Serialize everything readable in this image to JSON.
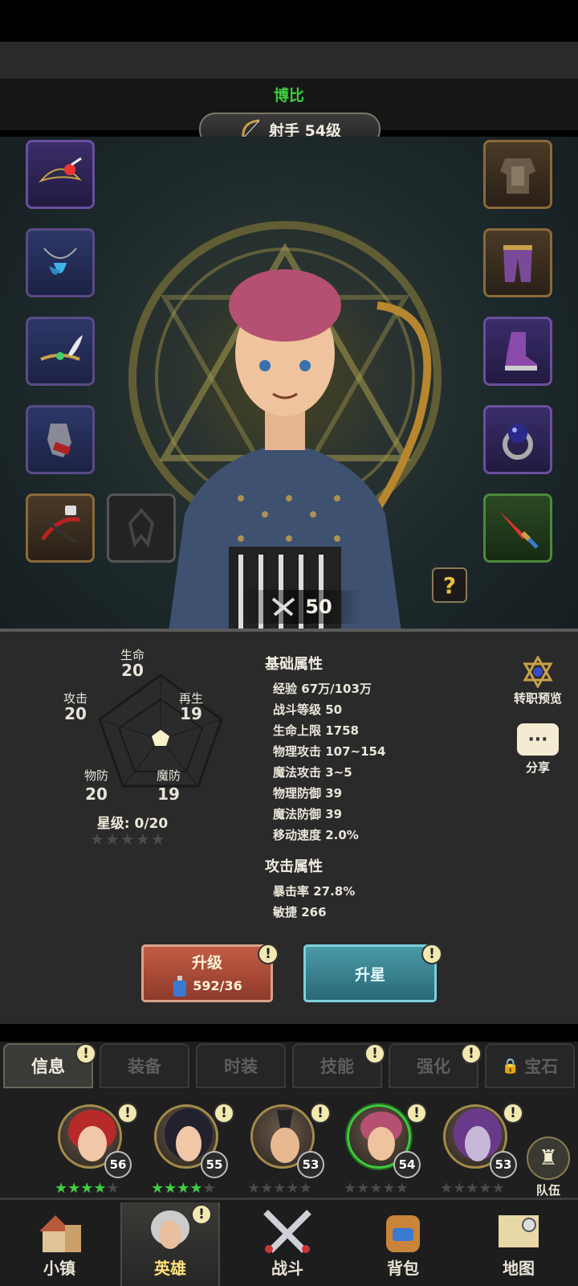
{
  "hero": {
    "name": "博比",
    "class_level": "射手 54级",
    "power": "50"
  },
  "equipment": {
    "left": [
      {
        "icon": "pirate-hat-icon",
        "rarity": "purple"
      },
      {
        "icon": "feather-necklace-icon",
        "rarity": "blue"
      },
      {
        "icon": "winged-circlet-icon",
        "rarity": "blue"
      },
      {
        "icon": "gauntlet-icon",
        "rarity": "blue"
      },
      {
        "icon": "locked-crossbow-icon",
        "rarity": "brown"
      }
    ],
    "right": [
      {
        "icon": "chest-armor-icon",
        "rarity": "brown"
      },
      {
        "icon": "leg-armor-icon",
        "rarity": "brown"
      },
      {
        "icon": "boots-icon",
        "rarity": "purple"
      },
      {
        "icon": "orb-ring-icon",
        "rarity": "purple"
      },
      {
        "icon": "dagger-icon",
        "rarity": "green"
      }
    ],
    "help": "?"
  },
  "radar": {
    "hp": {
      "label": "生命",
      "value": "20"
    },
    "regen": {
      "label": "再生",
      "value": "19"
    },
    "mdef": {
      "label": "魔防",
      "value": "19"
    },
    "pdef": {
      "label": "物防",
      "value": "20"
    },
    "atk": {
      "label": "攻击",
      "value": "20"
    }
  },
  "star_level": "星级: 0/20",
  "base_attrs": {
    "title": "基础属性",
    "lines": [
      "经验 67万/103万",
      "战斗等级 50",
      "生命上限 1758",
      "物理攻击 107~154",
      "魔法攻击 3~5",
      "物理防御 39",
      "魔法防御 39",
      "移动速度 2.0%"
    ]
  },
  "attack_attrs": {
    "title": "攻击属性",
    "lines": [
      "暴击率 27.8%",
      "敏捷 266"
    ]
  },
  "side": {
    "job_preview": "转职预览",
    "share": "分享",
    "share_icon": "···"
  },
  "buttons": {
    "upgrade": "升级",
    "upgrade_cost": "592/36",
    "star_up": "升星",
    "alert": "!"
  },
  "tabs": [
    "信息",
    "装备",
    "时装",
    "技能",
    "强化",
    "宝石"
  ],
  "roster": [
    {
      "level": "56",
      "stars": 4
    },
    {
      "level": "55",
      "stars": 4
    },
    {
      "level": "53",
      "stars": 0
    },
    {
      "level": "54",
      "stars": 0
    },
    {
      "level": "53",
      "stars": 0
    }
  ],
  "team_label": "队伍",
  "nav": [
    "小镇",
    "英雄",
    "战斗",
    "背包",
    "地图"
  ],
  "colors": {
    "name_green": "#3ccf3c",
    "accent_gold": "#a38b4a",
    "upgrade_red": "#c25c44",
    "star_teal": "#4a9aa8"
  }
}
